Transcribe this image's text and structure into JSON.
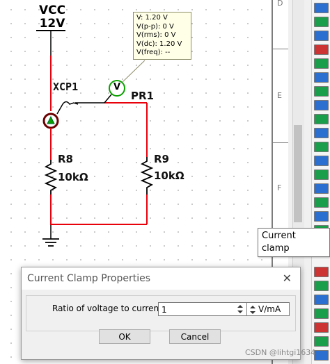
{
  "schematic": {
    "vcc_label": "VCC",
    "vcc_value": "12V",
    "probe_name": "XCP1",
    "probe_ref": "PR1",
    "probe_v_symbol": "V",
    "r8_name": "R8",
    "r8_value": "10kΩ",
    "r9_name": "R9",
    "r9_value": "10kΩ",
    "probe_readout": [
      "V: 1.20 V",
      "V(p-p): 0 V",
      "V(rms): 0 V",
      "V(dc): 1.20 V",
      "V(freq): --"
    ],
    "wire_color": "#e8000b",
    "component_color": "#000000"
  },
  "sheet_border": {
    "rows": [
      "D",
      "E",
      "F"
    ]
  },
  "toolbar_tooltip": "Current clamp",
  "dialog": {
    "title": "Current Clamp Properties",
    "ratio_label": "Ratio of voltage to current:",
    "ratio_value": "1",
    "unit_value": "V/mA",
    "ok_label": "OK",
    "cancel_label": "Cancel"
  },
  "watermark": "CSDN @lihtgi1634"
}
